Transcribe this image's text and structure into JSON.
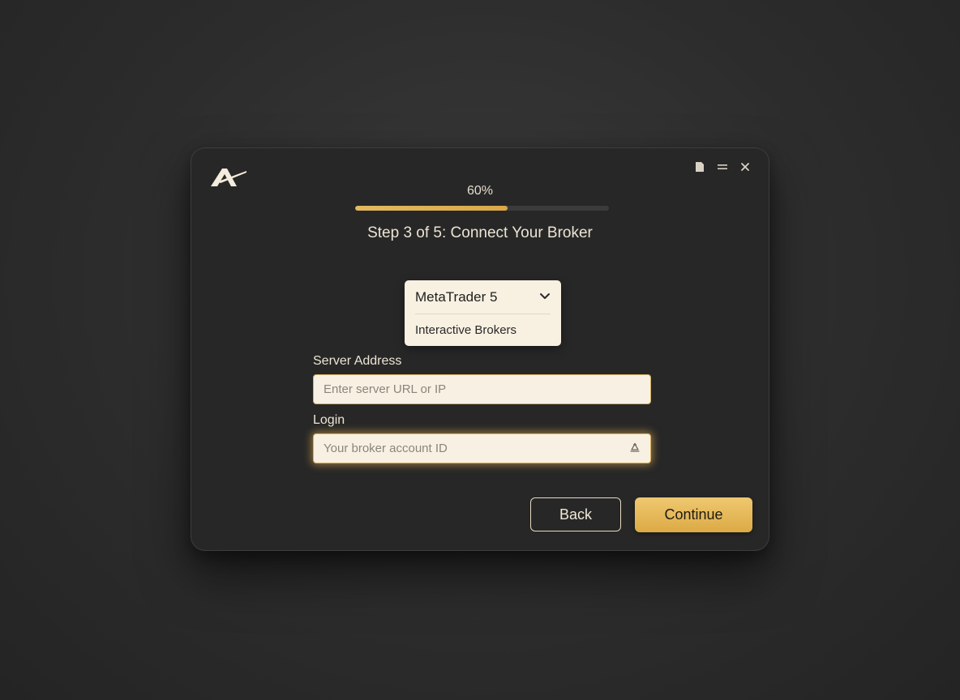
{
  "window": {
    "logo_name": "app-logo",
    "controls": [
      "note-icon",
      "menu-icon",
      "close-icon"
    ]
  },
  "progress": {
    "label": "60%",
    "value": 0.6,
    "accent_color": "#e0b456"
  },
  "step": {
    "title": "Step 3 of 5: Connect Your Broker"
  },
  "broker_select": {
    "selected": "MetaTrader 5",
    "options": [
      "Interactive Brokers"
    ]
  },
  "form": {
    "server_label": "Server Address",
    "server_placeholder": "Enter server URL or IP",
    "login_label": "Login",
    "login_placeholder": "Your broker account ID"
  },
  "actions": {
    "back_label": "Back",
    "continue_label": "Continue"
  }
}
